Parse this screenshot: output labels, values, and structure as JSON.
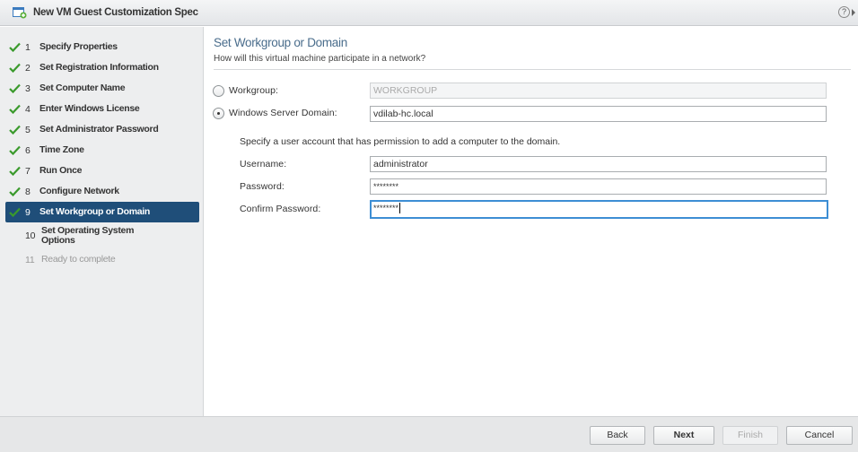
{
  "window": {
    "title": "New VM Guest Customization Spec",
    "help_icon": "?"
  },
  "steps": [
    {
      "num": "1",
      "label": "Specify Properties",
      "state": "done"
    },
    {
      "num": "2",
      "label": "Set Registration Information",
      "state": "done"
    },
    {
      "num": "3",
      "label": "Set Computer Name",
      "state": "done"
    },
    {
      "num": "4",
      "label": "Enter Windows License",
      "state": "done"
    },
    {
      "num": "5",
      "label": "Set Administrator Password",
      "state": "done"
    },
    {
      "num": "6",
      "label": "Time Zone",
      "state": "done"
    },
    {
      "num": "7",
      "label": "Run Once",
      "state": "done"
    },
    {
      "num": "8",
      "label": "Configure Network",
      "state": "done"
    },
    {
      "num": "9",
      "label": "Set Workgroup or Domain",
      "state": "active"
    },
    {
      "num": "10",
      "label": "Set Operating System Options",
      "state": "next"
    },
    {
      "num": "11",
      "label": "Ready to complete",
      "state": "future"
    }
  ],
  "page": {
    "title": "Set Workgroup or Domain",
    "subtitle": "How will this virtual machine participate in a network?",
    "workgroup": {
      "label": "Workgroup:",
      "value": "WORKGROUP",
      "selected": false
    },
    "domain": {
      "label": "Windows Server Domain:",
      "value": "vdilab-hc.local",
      "selected": true
    },
    "info": "Specify a user account that has permission to add a computer to the domain.",
    "username": {
      "label": "Username:",
      "value": "administrator"
    },
    "password": {
      "label": "Password:",
      "value": "********"
    },
    "confirm_password": {
      "label": "Confirm Password:",
      "value": "********"
    }
  },
  "footer": {
    "back": "Back",
    "next": "Next",
    "finish": "Finish",
    "cancel": "Cancel"
  },
  "colors": {
    "active_step_bg": "#1f4e79",
    "check_green": "#3a9a2c",
    "title_blue": "#4a6d8c",
    "focus_border": "#3d8ed4"
  }
}
